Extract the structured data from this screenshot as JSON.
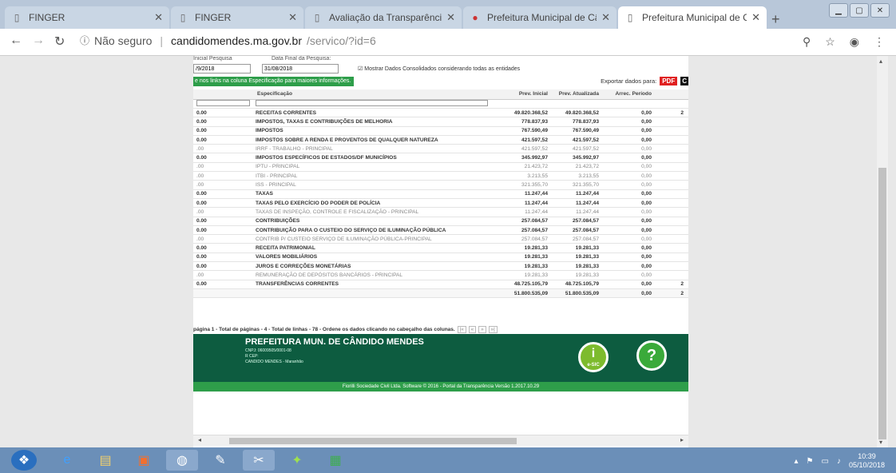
{
  "browser": {
    "tabs": [
      {
        "title": "FINGER",
        "active": false
      },
      {
        "title": "FINGER",
        "active": false
      },
      {
        "title": "Avaliação da Transparência dos",
        "active": false
      },
      {
        "title": "Prefeitura Municipal de Cândid",
        "active": false
      },
      {
        "title": "Prefeitura Municipal de Cândid",
        "active": true
      }
    ],
    "new_tab": "+",
    "security_label": "Não seguro",
    "url_domain": "candidomendes.ma.gov.br",
    "url_path": "/servico/?id=6"
  },
  "filters": {
    "start_label": "Inicial Pesquisa",
    "start_value": "/9/2018",
    "end_label": "Data Final da Pesquisa:",
    "end_value": "31/08/2018",
    "consolidated_label": "Mostrar Dados Consolidados considerando todas as entidades"
  },
  "banner": "e nos links na coluna Especificação para maiores informações.",
  "export": {
    "label": "Exportar dados para:",
    "pdf": "PDF",
    "csv": "C"
  },
  "table": {
    "headers": [
      "",
      "Especificação",
      "Prev. Inicial",
      "Prev. Atualizada",
      "Arrec. Período",
      ""
    ],
    "rows": [
      {
        "style": "bold",
        "c0": "0.00",
        "spec": "RECEITAS CORRENTES",
        "ini": "49.820.368,52",
        "atu": "49.820.368,52",
        "arr": "0,00",
        "ext": "2"
      },
      {
        "style": "bold",
        "c0": "0.00",
        "spec": "IMPOSTOS, TAXAS E CONTRIBUIÇÕES DE MELHORIA",
        "ini": "778.837,93",
        "atu": "778.837,93",
        "arr": "0,00",
        "ext": ""
      },
      {
        "style": "bold",
        "c0": "0.00",
        "spec": "IMPOSTOS",
        "ini": "767.590,49",
        "atu": "767.590,49",
        "arr": "0,00",
        "ext": ""
      },
      {
        "style": "bold",
        "c0": "0.00",
        "spec": "IMPOSTOS SOBRE A RENDA E PROVENTOS DE QUALQUER NATUREZA",
        "ini": "421.597,52",
        "atu": "421.597,52",
        "arr": "0,00",
        "ext": ""
      },
      {
        "style": "light",
        "c0": ".00",
        "spec": "IRRF - TRABALHO - PRINCIPAL",
        "ini": "421.597,52",
        "atu": "421.597,52",
        "arr": "0,00",
        "ext": ""
      },
      {
        "style": "bold",
        "c0": "0.00",
        "spec": "IMPOSTOS ESPECÍFICOS DE ESTADOS/DF MUNICÍPIOS",
        "ini": "345.992,97",
        "atu": "345.992,97",
        "arr": "0,00",
        "ext": ""
      },
      {
        "style": "light",
        "c0": ".00",
        "spec": "IPTU - PRINCIPAL",
        "ini": "21.423,72",
        "atu": "21.423,72",
        "arr": "0,00",
        "ext": ""
      },
      {
        "style": "light",
        "c0": ".00",
        "spec": "ITBI - PRINCIPAL",
        "ini": "3.213,55",
        "atu": "3.213,55",
        "arr": "0,00",
        "ext": ""
      },
      {
        "style": "light",
        "c0": ".00",
        "spec": "ISS - PRINCIPAL",
        "ini": "321.355,70",
        "atu": "321.355,70",
        "arr": "0,00",
        "ext": ""
      },
      {
        "style": "bold",
        "c0": "0.00",
        "spec": "TAXAS",
        "ini": "11.247,44",
        "atu": "11.247,44",
        "arr": "0,00",
        "ext": ""
      },
      {
        "style": "bold",
        "c0": "0.00",
        "spec": "TAXAS PELO EXERCÍCIO DO PODER DE POLÍCIA",
        "ini": "11.247,44",
        "atu": "11.247,44",
        "arr": "0,00",
        "ext": ""
      },
      {
        "style": "light",
        "c0": ".00",
        "spec": "TAXAS DE INSPEÇÃO, CONTROLE E FISCALIZAÇÃO - PRINCIPAL",
        "ini": "11.247,44",
        "atu": "11.247,44",
        "arr": "0,00",
        "ext": ""
      },
      {
        "style": "bold",
        "c0": "0.00",
        "spec": "CONTRIBUIÇÕES",
        "ini": "257.084,57",
        "atu": "257.084,57",
        "arr": "0,00",
        "ext": ""
      },
      {
        "style": "bold",
        "c0": "0.00",
        "spec": "CONTRIBUIÇÃO PARA O CUSTEIO DO SERVIÇO DE ILUMINAÇÃO PÚBLICA",
        "ini": "257.084,57",
        "atu": "257.084,57",
        "arr": "0,00",
        "ext": ""
      },
      {
        "style": "light",
        "c0": ".00",
        "spec": "CONTRIB P/ CUSTEIO SERVIÇO DE ILUMINAÇÃO PÚBLICA-PRINCIPAL",
        "ini": "257.084,57",
        "atu": "257.084,57",
        "arr": "0,00",
        "ext": ""
      },
      {
        "style": "bold",
        "c0": "0.00",
        "spec": "RECEITA PATRIMONIAL",
        "ini": "19.281,33",
        "atu": "19.281,33",
        "arr": "0,00",
        "ext": ""
      },
      {
        "style": "bold",
        "c0": "0.00",
        "spec": "VALORES MOBILIÁRIOS",
        "ini": "19.281,33",
        "atu": "19.281,33",
        "arr": "0,00",
        "ext": ""
      },
      {
        "style": "bold",
        "c0": "0.00",
        "spec": "JUROS E CORREÇÕES MONETÁRIAS",
        "ini": "19.281,33",
        "atu": "19.281,33",
        "arr": "0,00",
        "ext": ""
      },
      {
        "style": "light",
        "c0": ".00",
        "spec": "REMUNERAÇÃO DE DEPÓSITOS BANCÁRIOS - PRINCIPAL",
        "ini": "19.281,33",
        "atu": "19.281,33",
        "arr": "0,00",
        "ext": ""
      },
      {
        "style": "bold",
        "c0": "0.00",
        "spec": "TRANSFERÊNCIAS CORRENTES",
        "ini": "48.725.105,79",
        "atu": "48.725.105,79",
        "arr": "0,00",
        "ext": "2"
      }
    ],
    "total": {
      "ini": "51.800.535,09",
      "atu": "51.800.535,09",
      "arr": "0,00",
      "ext": "2"
    }
  },
  "pager": {
    "text": "página 1 - Total de páginas - 4 - Total de linhas - 78 - Ordene os dados clicando no cabeçalho das colunas.",
    "first": "|«",
    "prev": "«",
    "next": "»",
    "last": "»|"
  },
  "footer": {
    "name": "PREFEITURA MUN. DE CÂNDIDO MENDES",
    "cnpj": "CNPJ: 06009505/0001-08",
    "cep": "R CEP:",
    "city": "CANDIDO MENDES - Maranhão",
    "esic_label": "e-SIC",
    "copyright": "Fiorilli Sociedade Civil Ltda. Software © 2016 - Portal da Transparência Versão 1.2017.10.29"
  },
  "taskbar": {
    "time": "10:39",
    "date": "05/10/2018"
  }
}
